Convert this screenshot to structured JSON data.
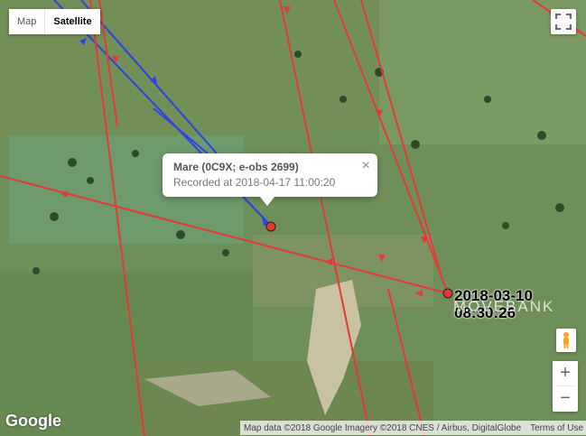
{
  "map_type_control": {
    "map_label": "Map",
    "satellite_label": "Satellite",
    "selected": "Satellite"
  },
  "info_window": {
    "title": "Mare (0C9X; e-obs 2699)",
    "subtitle": "Recorded at 2018-04-17 11:00:20",
    "close_glyph": "×"
  },
  "point_label": {
    "date": "2018-03-10",
    "time": "08:30:26"
  },
  "watermark": "MOVEBANK",
  "zoom": {
    "in_label": "+",
    "out_label": "−"
  },
  "attribution": {
    "data": "Map data ©2018 Google Imagery ©2018 CNES / Airbus, DigitalGlobe",
    "terms": "Terms of Use"
  },
  "logo": "Google",
  "track_colors": {
    "red": "#e53935",
    "blue": "#2d44e0"
  },
  "icons": [
    "fullscreen-icon",
    "pegman-icon",
    "close-icon"
  ]
}
